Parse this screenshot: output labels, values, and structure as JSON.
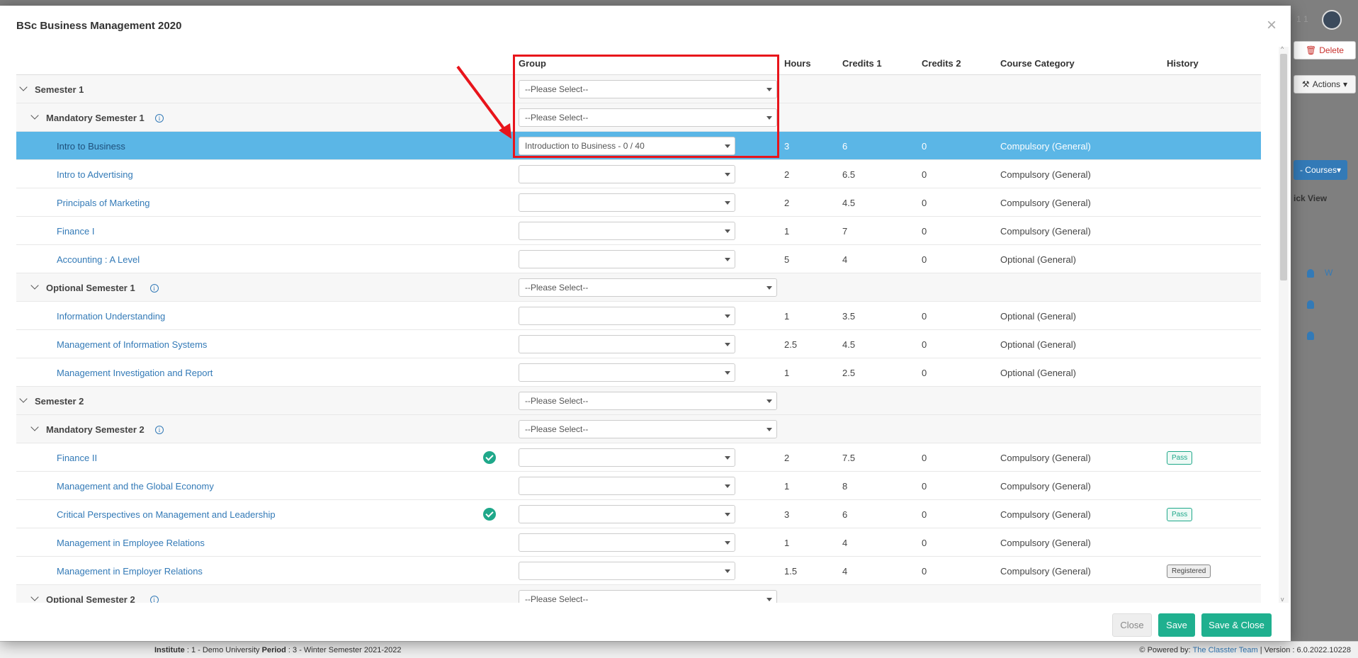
{
  "modal": {
    "title": "BSc Business Management 2020",
    "close_icon": "×"
  },
  "columns": {
    "group": "Group",
    "hours": "Hours",
    "credits1": "Credits 1",
    "credits2": "Credits 2",
    "category": "Course Category",
    "history": "History"
  },
  "rows": [
    {
      "type": "semester",
      "name": "Semester 1",
      "select": "--Please Select--"
    },
    {
      "type": "section",
      "name": "Mandatory Semester 1",
      "select": "--Please Select--"
    },
    {
      "type": "course",
      "name": "Intro to Business",
      "select": "Introduction to Business - 0 / 40",
      "hours": "3",
      "c1": "6",
      "c2": "0",
      "cat": "Compulsory (General)",
      "selected": true
    },
    {
      "type": "course",
      "name": "Intro to Advertising",
      "select": "",
      "hours": "2",
      "c1": "6.5",
      "c2": "0",
      "cat": "Compulsory (General)"
    },
    {
      "type": "course",
      "name": "Principals of Marketing",
      "select": "",
      "hours": "2",
      "c1": "4.5",
      "c2": "0",
      "cat": "Compulsory (General)"
    },
    {
      "type": "course",
      "name": "Finance I",
      "select": "",
      "hours": "1",
      "c1": "7",
      "c2": "0",
      "cat": "Compulsory (General)"
    },
    {
      "type": "course",
      "name": "Accounting : A Level",
      "select": "",
      "hours": "5",
      "c1": "4",
      "c2": "0",
      "cat": "Optional (General)"
    },
    {
      "type": "section",
      "name": "Optional Semester 1",
      "select": "--Please Select--"
    },
    {
      "type": "course",
      "name": "Information Understanding",
      "select": "",
      "hours": "1",
      "c1": "3.5",
      "c2": "0",
      "cat": "Optional (General)"
    },
    {
      "type": "course",
      "name": "Management of Information Systems",
      "select": "",
      "hours": "2.5",
      "c1": "4.5",
      "c2": "0",
      "cat": "Optional (General)"
    },
    {
      "type": "course",
      "name": "Management Investigation and Report",
      "select": "",
      "hours": "1",
      "c1": "2.5",
      "c2": "0",
      "cat": "Optional (General)"
    },
    {
      "type": "semester",
      "name": "Semester 2",
      "select": "--Please Select--"
    },
    {
      "type": "section",
      "name": "Mandatory Semester 2",
      "select": "--Please Select--"
    },
    {
      "type": "course",
      "name": "Finance II",
      "select": "",
      "hours": "2",
      "c1": "7.5",
      "c2": "0",
      "cat": "Compulsory (General)",
      "check": true,
      "history": "Pass"
    },
    {
      "type": "course",
      "name": "Management and the Global Economy",
      "select": "",
      "hours": "1",
      "c1": "8",
      "c2": "0",
      "cat": "Compulsory (General)"
    },
    {
      "type": "course",
      "name": "Critical Perspectives on Management and Leadership",
      "select": "",
      "hours": "3",
      "c1": "6",
      "c2": "0",
      "cat": "Compulsory (General)",
      "check": true,
      "history": "Pass"
    },
    {
      "type": "course",
      "name": "Management in Employee Relations",
      "select": "",
      "hours": "1",
      "c1": "4",
      "c2": "0",
      "cat": "Compulsory (General)"
    },
    {
      "type": "course",
      "name": "Management in Employer Relations",
      "select": "",
      "hours": "1.5",
      "c1": "4",
      "c2": "0",
      "cat": "Compulsory (General)",
      "history": "Registered"
    },
    {
      "type": "section",
      "name": "Optional Semester 2",
      "select": "--Please Select--"
    }
  ],
  "buttons": {
    "close": "Close",
    "save": "Save",
    "save_close": "Save & Close"
  },
  "background": {
    "delete": "Delete",
    "actions": "Actions",
    "courses": "- Courses",
    "quick_view": "ick View",
    "user_num": "1 1",
    "w_label": "W"
  },
  "footer": {
    "institute_label": "Institute",
    "institute_value": ": 1 - Demo University",
    "period_label": "Period",
    "period_value": ": 3 - Winter Semester 2021-2022",
    "powered_by": "Powered by:",
    "team": "The Classter Team",
    "version": "| Version : 6.0.2022.10228"
  },
  "colors": {
    "selected_row": "#5bb6e6",
    "link": "#337ab7",
    "accent": "#1fb08f",
    "highlight": "#e8141b"
  }
}
